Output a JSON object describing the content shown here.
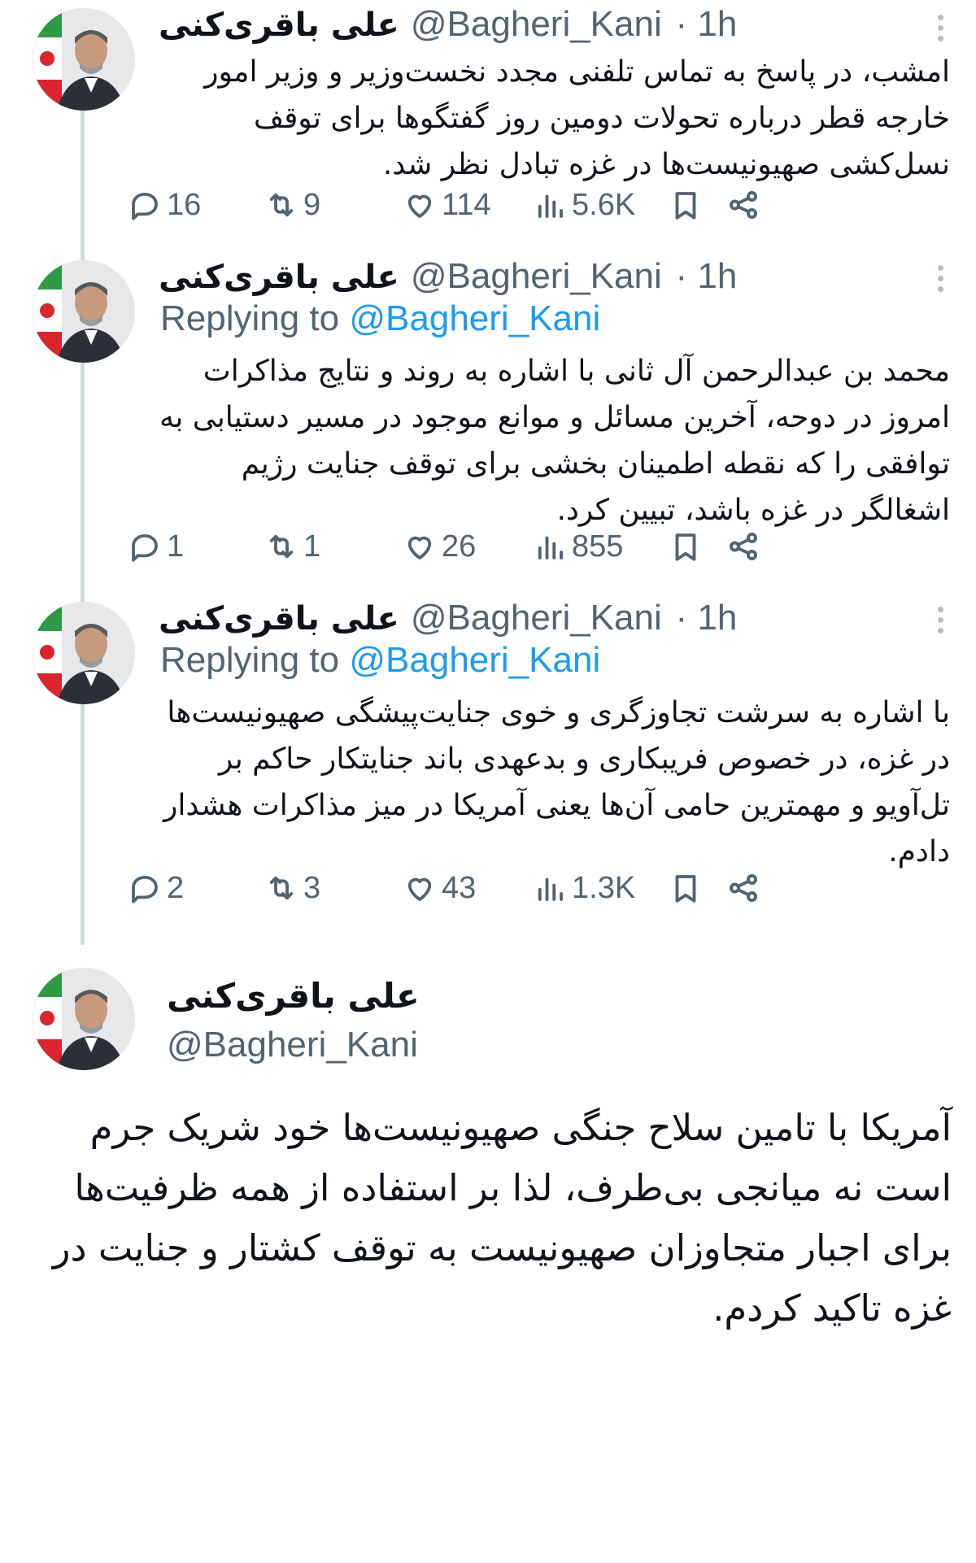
{
  "tweets": [
    {
      "name": "علی باقری‌کنی",
      "handle": "@Bagheri_Kani",
      "time": "· 1h",
      "replying_prefix": "",
      "replying_to": "",
      "text": "امشب، در پاسخ به تماس تلفنی مجدد نخست‌وزیر و وزیر امور خارجه قطر درباره تحولات دومین روز گفتگوها برای توقف نسل‌کشی صهیونیست‌ها در غزه تبادل نظر شد.",
      "replies": "16",
      "reposts": "9",
      "likes": "114",
      "views": "5.6K"
    },
    {
      "name": "علی باقری‌کنی",
      "handle": "@Bagheri_Kani",
      "time": "· 1h",
      "replying_prefix": "Replying to",
      "replying_to": "@Bagheri_Kani",
      "text": "محمد بن عبدالرحمن آل ثانی با اشاره به روند و نتایج مذاکرات امروز در دوحه، آخرین مسائل و موانع موجود در مسیر دستیابی به توافقی را که نقطه اطمینان بخشی برای توقف جنایت رژیم اشغالگر در غزه باشد، تبیین کرد.",
      "replies": "1",
      "reposts": "1",
      "likes": "26",
      "views": "855"
    },
    {
      "name": "علی باقری‌کنی",
      "handle": "@Bagheri_Kani",
      "time": "· 1h",
      "replying_prefix": "Replying to",
      "replying_to": "@Bagheri_Kani",
      "text": "با اشاره به سرشت تجاوزگری و خوی جنایت‌پیشگی صهیونیست‌ها در غزه، در خصوص فریبکاری و بدعهدی باند جنایتکار حاکم بر تل‌آویو و مهمترین حامی آن‌ها یعنی آمریکا در میز مذاکرات هشدار دادم.",
      "replies": "2",
      "reposts": "3",
      "likes": "43",
      "views": "1.3K"
    }
  ],
  "main_tweet": {
    "name": "علی باقری‌کنی",
    "handle": "@Bagheri_Kani",
    "text": "آمریکا با تامین سلاح جنگی صهیونیست‌ها خود شریک جرم است نه میانجی بی‌طرف، لذا بر استفاده از همه ظرفیت‌ها برای اجبار متجاوزان صهیونیست به توقف کشتار و جنایت در غزه تاکید کردم."
  },
  "colors": {
    "text": "#0f1419",
    "secondary": "#536471",
    "mention": "#1d9bf0",
    "thread_line": "#cfd9de"
  },
  "icons": [
    "reply-icon",
    "repost-icon",
    "like-icon",
    "views-icon",
    "bookmark-icon",
    "share-icon",
    "more-icon"
  ]
}
